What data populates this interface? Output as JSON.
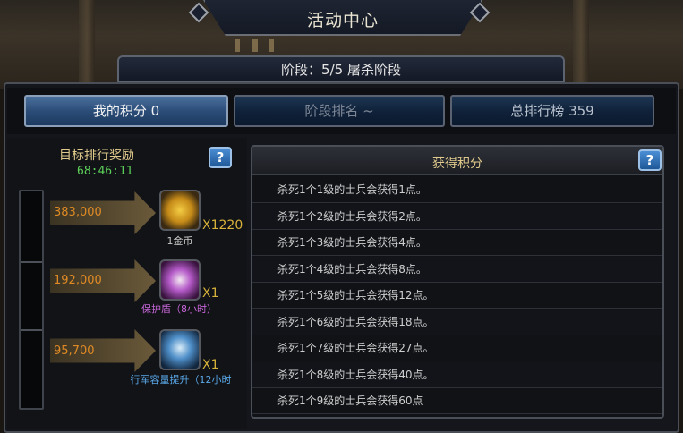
{
  "window": {
    "title": "活动中心"
  },
  "stage": {
    "label": "阶段：5/5 屠杀阶段"
  },
  "tabs": [
    {
      "label": "我的积分 0"
    },
    {
      "label": "阶段排名 ~"
    },
    {
      "label": "总排行榜 359"
    }
  ],
  "rewards_panel": {
    "title": "目标排行奖励",
    "timer": "68:46:11",
    "help": "?",
    "tiers": [
      {
        "threshold": "383,000",
        "icon": "gold-coin-icon",
        "quantity": "X1220",
        "name": "1金币",
        "name_color": "#c8c8c8"
      },
      {
        "threshold": "192,000",
        "icon": "shield-wings-icon",
        "quantity": "X1",
        "name": "保护盾（8小时）",
        "name_color": "#c866d8"
      },
      {
        "threshold": "95,700",
        "icon": "march-capacity-icon",
        "quantity": "X1",
        "name": "行军容量提升（12小时",
        "name_color": "#5aa8e8"
      }
    ]
  },
  "points_panel": {
    "title": "获得积分",
    "help": "?",
    "rules": [
      "杀死1个1级的士兵会获得1点。",
      "杀死1个2级的士兵会获得2点。",
      "杀死1个3级的士兵会获得4点。",
      "杀死1个4级的士兵会获得8点。",
      "杀死1个5级的士兵会获得12点。",
      "杀死1个6级的士兵会获得18点。",
      "杀死1个7级的士兵会获得27点。",
      "杀死1个8级的士兵会获得40点。",
      "杀死1个9级的士兵会获得60点"
    ]
  },
  "colors": {
    "accent_gold": "#e0c98c",
    "timer_green": "#5dd15a",
    "threshold_orange": "#e08a24",
    "tab_blue": "#2b4d78"
  }
}
